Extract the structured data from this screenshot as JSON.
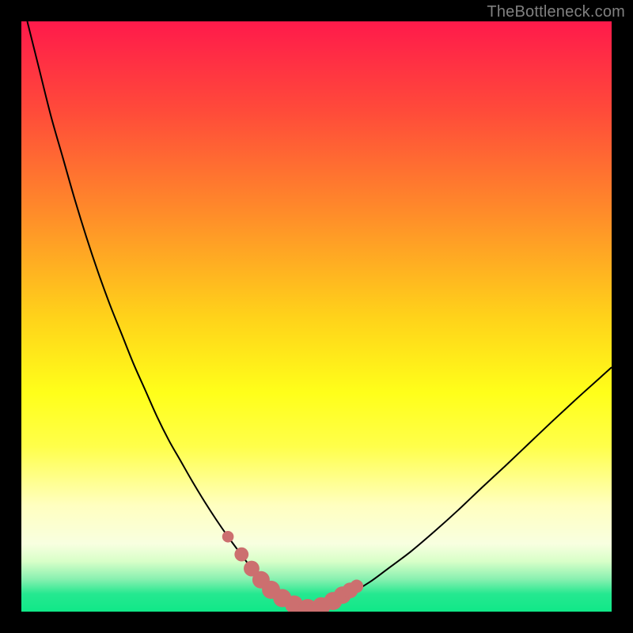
{
  "watermark": {
    "text": "TheBottleneck.com"
  },
  "colors": {
    "frame": "#000000",
    "curve": "#000000",
    "dots": "#cc6f6f",
    "gradient_stops": [
      {
        "offset": 0.0,
        "color": "#ff1a4b"
      },
      {
        "offset": 0.15,
        "color": "#ff4a3a"
      },
      {
        "offset": 0.32,
        "color": "#ff8a2a"
      },
      {
        "offset": 0.5,
        "color": "#ffd21a"
      },
      {
        "offset": 0.63,
        "color": "#ffff1a"
      },
      {
        "offset": 0.72,
        "color": "#ffff4a"
      },
      {
        "offset": 0.82,
        "color": "#ffffc0"
      },
      {
        "offset": 0.885,
        "color": "#f8ffe0"
      },
      {
        "offset": 0.915,
        "color": "#d8ffc8"
      },
      {
        "offset": 0.945,
        "color": "#88f0b0"
      },
      {
        "offset": 0.97,
        "color": "#25e890"
      },
      {
        "offset": 1.0,
        "color": "#10e888"
      }
    ]
  },
  "chart_data": {
    "type": "line",
    "title": "",
    "xlabel": "",
    "ylabel": "",
    "xlim": [
      0,
      100
    ],
    "ylim": [
      0,
      100
    ],
    "series": [
      {
        "name": "bottleneck-curve",
        "x": [
          1,
          3,
          5,
          7,
          9,
          11,
          13,
          15,
          17,
          19,
          21,
          23,
          25,
          27,
          29,
          31,
          33,
          35,
          37,
          38.5,
          40,
          42,
          44,
          46,
          48,
          50,
          53,
          56,
          59,
          62,
          66,
          70,
          74,
          78,
          82,
          86,
          90,
          94,
          98,
          100
        ],
        "y": [
          100,
          92,
          84,
          77,
          70,
          63.5,
          57.5,
          52,
          47,
          42,
          37.5,
          33,
          29,
          25.5,
          22,
          18.7,
          15.6,
          12.7,
          10,
          8,
          6.2,
          4,
          2.4,
          1.2,
          0.6,
          0.9,
          1.8,
          3.2,
          5,
          7.2,
          10.2,
          13.6,
          17.2,
          21,
          24.7,
          28.5,
          32.3,
          36,
          39.6,
          41.4
        ]
      }
    ],
    "markers": {
      "name": "optimal-zone-dots",
      "x": [
        35,
        37.3,
        39,
        40.6,
        42.3,
        44.2,
        46.2,
        48.5,
        50.8,
        52.8,
        54.4,
        55.7,
        56.8
      ],
      "y": [
        12.7,
        9.7,
        7.3,
        5.4,
        3.7,
        2.3,
        1.2,
        0.6,
        0.9,
        1.8,
        2.8,
        3.6,
        4.3
      ],
      "r": [
        7,
        8.5,
        9.5,
        10.5,
        11,
        11,
        11,
        11,
        11,
        11,
        10.5,
        9.5,
        8
      ]
    }
  }
}
